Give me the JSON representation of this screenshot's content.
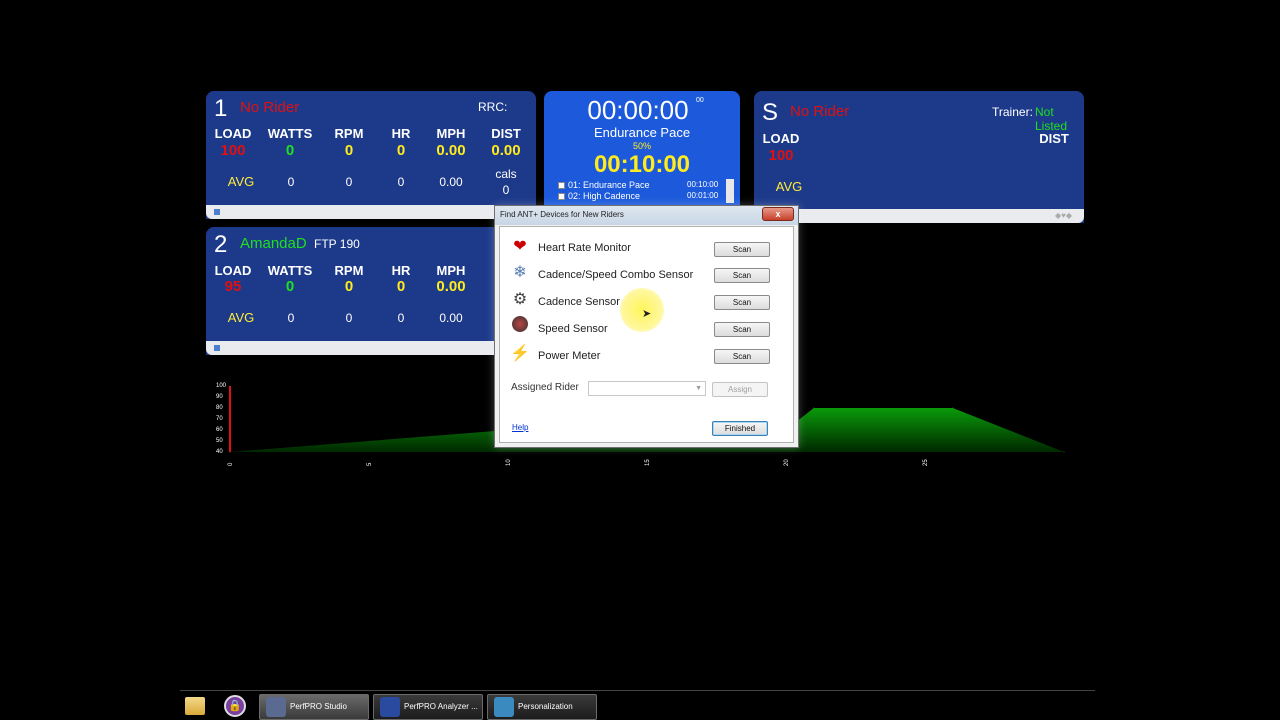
{
  "rider1": {
    "number": "1",
    "name": "No Rider",
    "rrc_label": "RRC:",
    "headers": [
      "LOAD",
      "WATTS",
      "RPM",
      "HR",
      "MPH",
      "DIST"
    ],
    "values": [
      "100",
      "0",
      "0",
      "0",
      "0.00",
      "0.00"
    ],
    "avg_label": "AVG",
    "avg_values": [
      "0",
      "0",
      "0",
      "0.00"
    ],
    "cals_label": "cals",
    "cals_value": "0"
  },
  "rider2": {
    "number": "2",
    "name": "AmandaD",
    "ftp": "FTP 190",
    "headers": [
      "LOAD",
      "WATTS",
      "RPM",
      "HR",
      "MPH"
    ],
    "values": [
      "95",
      "0",
      "0",
      "0",
      "0.00"
    ],
    "avg_label": "AVG",
    "avg_values": [
      "0",
      "0",
      "0",
      "0.00"
    ]
  },
  "riderS": {
    "number": "S",
    "name": "No Rider",
    "trainer_label": "Trainer:",
    "trainer_value": "Not Listed",
    "load_label": "LOAD",
    "dist_label": "DIST",
    "load_value": "100",
    "avg_label": "AVG"
  },
  "timer": {
    "elapsed": "00:00:00",
    "elapsed_sub": "00",
    "segment": "Endurance Pace",
    "percent": "50%",
    "remaining": "00:10:00",
    "intervals": [
      {
        "label": "01:  Endurance Pace",
        "time": "00:10:00"
      },
      {
        "label": "02:  High Cadence",
        "time": "00:01:00"
      }
    ]
  },
  "dialog": {
    "title": "Find ANT+ Devices for New Riders",
    "close_label": "x",
    "devices": [
      {
        "label": "Heart Rate Monitor",
        "icon": "heart-icon"
      },
      {
        "label": "Cadence/Speed Combo Sensor",
        "icon": "combo-sensor-icon"
      },
      {
        "label": "Cadence Sensor",
        "icon": "cadence-sensor-icon"
      },
      {
        "label": "Speed Sensor",
        "icon": "speed-sensor-icon"
      },
      {
        "label": "Power Meter",
        "icon": "lightning-icon"
      }
    ],
    "scan_label": "Scan",
    "assigned_rider_label": "Assigned Rider",
    "assigned_rider_value": "",
    "assign_label": "Assign",
    "help_label": "Help",
    "finished_label": "Finished"
  },
  "chart": {
    "y_ticks": [
      "100",
      "90",
      "80",
      "70",
      "60",
      "50",
      "40"
    ],
    "x_ticks": [
      "0",
      "5",
      "10",
      "15",
      "20",
      "25"
    ]
  },
  "chart_data": {
    "type": "area",
    "x": [
      0,
      10,
      20,
      21,
      26,
      30
    ],
    "y": [
      40,
      60,
      60,
      80,
      80,
      40
    ],
    "ylim": [
      40,
      100
    ],
    "xlim": [
      0,
      30
    ],
    "grid": false
  },
  "taskbar": {
    "items": [
      {
        "label": "PerfPRO Studio"
      },
      {
        "label": "PerfPRO Analyzer ..."
      },
      {
        "label": "Personalization"
      }
    ]
  },
  "colors": {
    "panel": "#1d3a8a",
    "timer": "#1d5adb",
    "accent_red": "#e01010",
    "accent_green": "#1ee01e",
    "accent_yellow": "#ffeb1e"
  }
}
